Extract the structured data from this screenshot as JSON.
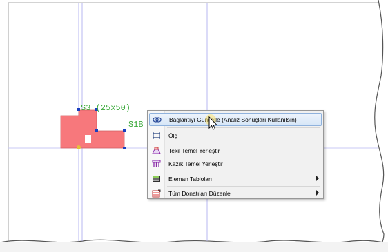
{
  "drawing": {
    "column_label": "S3 (25x50)",
    "beam_label": "S1B"
  },
  "context_menu": {
    "items": [
      {
        "label": "Bağlantıyı Güncelle (Analiz Sonuçları Kullanılsın)",
        "icon": "link-update-icon",
        "highlighted": true,
        "submenu": false
      },
      {
        "label": "Ölç",
        "icon": "measure-icon",
        "highlighted": false,
        "submenu": false
      },
      {
        "label": "Tekil Temel Yerleştir",
        "icon": "single-foundation-icon",
        "highlighted": false,
        "submenu": false
      },
      {
        "label": "Kazık Temel Yerleştir",
        "icon": "pile-foundation-icon",
        "highlighted": false,
        "submenu": false
      },
      {
        "label": "Eleman Tabloları",
        "icon": "element-tables-icon",
        "highlighted": false,
        "submenu": true
      },
      {
        "label": "Tüm Donatıları Düzenle",
        "icon": "edit-rebar-icon",
        "highlighted": false,
        "submenu": true
      }
    ]
  },
  "colors": {
    "guide_line": "#b7b7f2",
    "column_fill": "#f7787c",
    "label_text": "#3caa3c",
    "menu_highlight": "#d6e6f7"
  }
}
